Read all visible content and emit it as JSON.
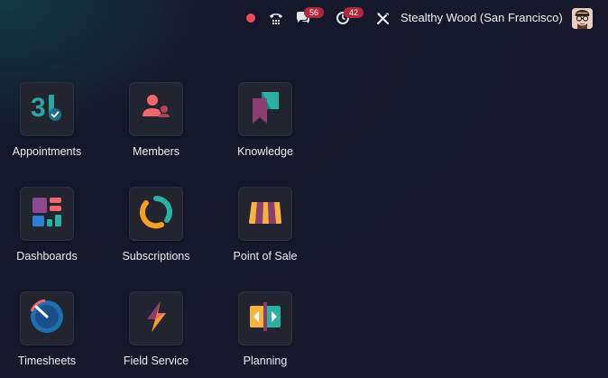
{
  "topbar": {
    "messages_count": "56",
    "activities_count": "42",
    "company_name": "Stealthy Wood (San Francisco)",
    "icons": [
      "recording-dot-icon",
      "phone-icon",
      "chat-icon",
      "clock-icon",
      "tools-icon",
      "user-avatar"
    ]
  },
  "apps": [
    {
      "label": "Appointments",
      "icon": "calendar-31-icon"
    },
    {
      "label": "Members",
      "icon": "members-icon"
    },
    {
      "label": "Knowledge",
      "icon": "knowledge-icon"
    },
    {
      "label": "Dashboards",
      "icon": "dashboards-icon"
    },
    {
      "label": "Subscriptions",
      "icon": "subscriptions-icon"
    },
    {
      "label": "Point of Sale",
      "icon": "point-of-sale-icon"
    },
    {
      "label": "Timesheets",
      "icon": "timesheets-icon"
    },
    {
      "label": "Field Service",
      "icon": "field-service-icon"
    },
    {
      "label": "Planning",
      "icon": "planning-icon"
    }
  ],
  "colors": {
    "background": "#1a1a2e",
    "tile": "#22252f",
    "badge": "#b3273a",
    "record_dot": "#ef4c5a"
  }
}
